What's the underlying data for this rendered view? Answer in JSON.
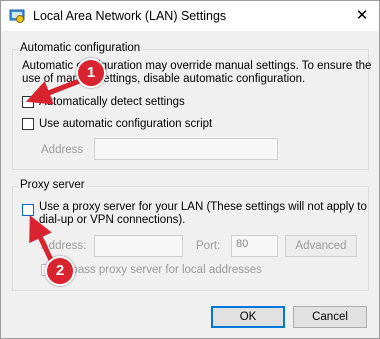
{
  "window": {
    "title": "Local Area Network (LAN) Settings",
    "close_glyph": "✕"
  },
  "auto_config": {
    "legend": "Automatic configuration",
    "description_line1": "Automatic configuration may override manual settings.  To ensure the",
    "description_line2": "use of manual settings, disable automatic configuration.",
    "detect_label": "Automatically detect settings",
    "detect_checked": false,
    "script_label": "Use automatic configuration script",
    "script_checked": false,
    "address_label": "Address",
    "address_value": ""
  },
  "proxy": {
    "legend": "Proxy server",
    "use_proxy_line1": "Use a proxy server for your LAN (These settings will not apply to",
    "use_proxy_line2": "dial-up or VPN connections).",
    "use_proxy_checked": false,
    "address_label": "Address:",
    "address_value": "",
    "port_label": "Port:",
    "port_value": "80",
    "advanced_label": "Advanced",
    "bypass_label": "Bypass proxy server for local addresses"
  },
  "buttons": {
    "ok": "OK",
    "cancel": "Cancel"
  },
  "annotations": {
    "step1": "1",
    "step2": "2",
    "color": "#d9232f"
  }
}
